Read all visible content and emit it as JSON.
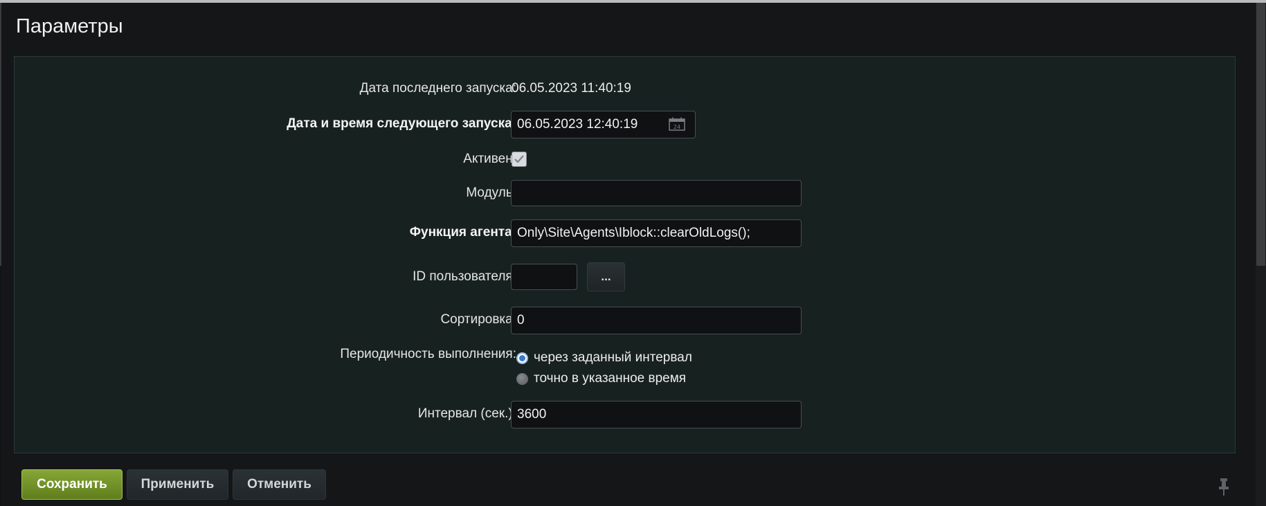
{
  "page_title": "Параметры",
  "fields": {
    "last_run": {
      "label": "Дата последнего запуска:",
      "value": "06.05.2023 11:40:19"
    },
    "next_run": {
      "label": "Дата и время следующего запуска:",
      "value": "06.05.2023 12:40:19",
      "icon": "calendar-icon",
      "calendar_day": "24"
    },
    "active": {
      "label": "Активен:",
      "checked": true
    },
    "module": {
      "label": "Модуль:",
      "value": ""
    },
    "agent_function": {
      "label": "Функция агента:",
      "value": "Only\\Site\\Agents\\Iblock::clearOldLogs();"
    },
    "user_id": {
      "label": "ID пользователя:",
      "value": "",
      "picker_label": "..."
    },
    "sort": {
      "label": "Сортировка:",
      "value": "0"
    },
    "periodicity": {
      "label": "Периодичность выполнения:",
      "options": [
        {
          "label": "через заданный интервал",
          "selected": true
        },
        {
          "label": "точно в указанное время",
          "selected": false
        }
      ]
    },
    "interval": {
      "label": "Интервал (сек.):",
      "value": "3600"
    }
  },
  "footer": {
    "save_label": "Сохранить",
    "apply_label": "Применить",
    "cancel_label": "Отменить",
    "pin_icon": "pin-icon"
  },
  "colors": {
    "save_button": "#6f8f28",
    "panel_background": "#172120",
    "page_background": "#141617"
  }
}
